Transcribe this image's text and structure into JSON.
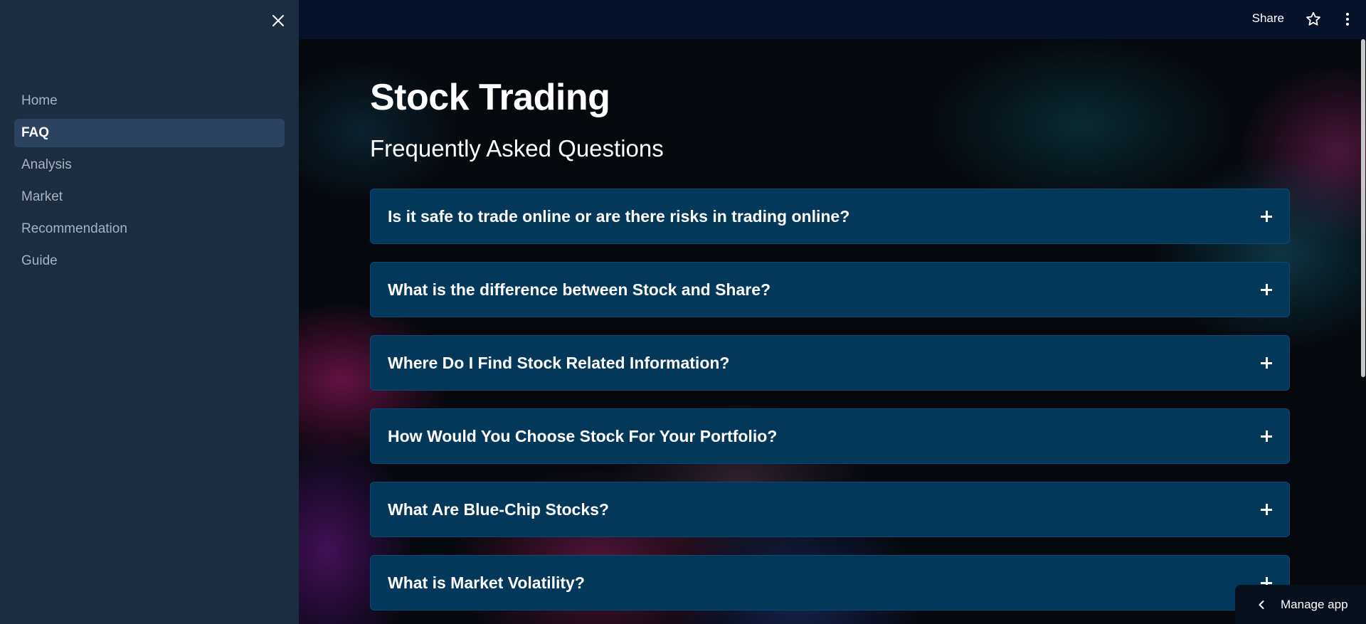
{
  "sidebar": {
    "close_icon": "close-icon",
    "items": [
      {
        "label": "Home",
        "active": false
      },
      {
        "label": "FAQ",
        "active": true
      },
      {
        "label": "Analysis",
        "active": false
      },
      {
        "label": "Market",
        "active": false
      },
      {
        "label": "Recommendation",
        "active": false
      },
      {
        "label": "Guide",
        "active": false
      }
    ]
  },
  "header": {
    "share_label": "Share",
    "star_icon": "star-icon",
    "menu_icon": "more-vertical-icon"
  },
  "main": {
    "title": "Stock Trading",
    "subtitle": "Frequently Asked Questions",
    "faq": [
      {
        "question": "Is it safe to trade online or are there risks in trading online?"
      },
      {
        "question": "What is the difference between Stock and Share?"
      },
      {
        "question": "Where Do I Find Stock Related Information?"
      },
      {
        "question": "How Would You Choose Stock For Your Portfolio?"
      },
      {
        "question": "What Are Blue-Chip Stocks?"
      },
      {
        "question": "What is Market Volatility?"
      }
    ]
  },
  "manage_app": {
    "label": "Manage app",
    "icon": "chevron-left-icon"
  },
  "colors": {
    "sidebar_bg": "#1c2d40",
    "sidebar_active": "#2b4260",
    "header_bg": "#06112a",
    "faq_bg": "#04385a"
  }
}
